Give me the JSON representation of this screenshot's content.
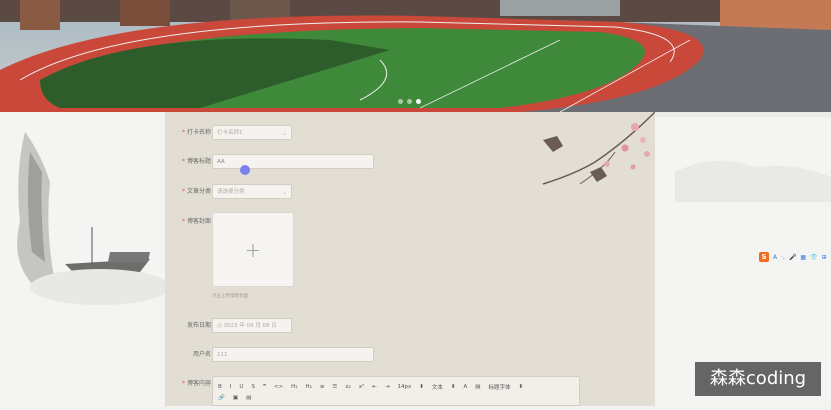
{
  "carousel": {
    "dots": 3,
    "active_index": 2
  },
  "form": {
    "fields": [
      {
        "label": "打卡名称",
        "required": true,
        "value": "打卡名称1",
        "kind": "select"
      },
      {
        "label": "博客标题",
        "required": true,
        "value": "AA",
        "kind": "input"
      },
      {
        "label": "文章分类",
        "required": true,
        "value": "请选择分类",
        "kind": "select"
      },
      {
        "label": "博客封面",
        "required": true,
        "kind": "upload"
      },
      {
        "label": "发布日期",
        "required": false,
        "value": "2023 年 04 月 08 日",
        "kind": "date"
      },
      {
        "label": "用户名",
        "required": false,
        "value": "111",
        "kind": "input"
      },
      {
        "label": "博客内容",
        "required": true,
        "kind": "editor"
      }
    ],
    "upload_plus": "+",
    "upload_hint": "点击上传博客封面"
  },
  "editor_toolbar": {
    "row1": [
      "B",
      "I",
      "U",
      "S",
      "❞",
      "<>",
      "H₁",
      "H₂",
      "≡",
      "☰",
      "x₂",
      "x²",
      "⇤",
      "⇥",
      "14px",
      "⬍",
      "文本",
      "⬍",
      "A",
      "▤",
      "标题字体",
      "⬍"
    ],
    "row2": [
      "🔗",
      "▣",
      "▤"
    ]
  },
  "ime": {
    "logo": "S",
    "items": [
      "A",
      "·,",
      "🎤",
      "▦",
      "👕",
      "⊞"
    ]
  },
  "watermark": "森森coding",
  "colors": {
    "track": "#c9483a",
    "field": "#3f8a3a",
    "panel": "#e3ded4",
    "accent": "#7b7ff0"
  }
}
